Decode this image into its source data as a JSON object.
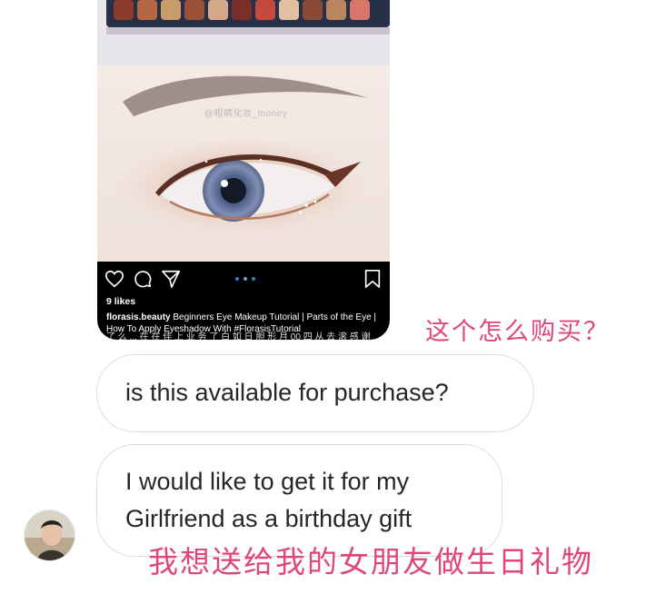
{
  "post": {
    "watermark": "@眼睛化妆_money",
    "likes": "9 likes",
    "username": "florasis.beauty",
    "caption": "Beginners Eye Makeup Tutorial | Parts of the Eye | How To Apply Eyeshadow With #FlorasisTutorial",
    "caption_cut": "了 么 ... 在 在 佳 上 业 务 了 白 如 日 胆 形 月 00 四 从 去 滚 感 谢",
    "icons": [
      "heart-icon",
      "comment-icon",
      "share-icon",
      "bookmark-icon"
    ],
    "carousel_dots": 3
  },
  "messages": [
    {
      "lines": [
        "is this available for purchase?"
      ]
    },
    {
      "lines": [
        "I would like to get it for my",
        "Girlfriend as a birthday gift"
      ]
    }
  ],
  "annotations": {
    "question": "这个怎么购买？",
    "gift": "我想送给我的女朋友做生日礼物"
  },
  "colors": {
    "annotation": "#e0457b",
    "bubble_border": "#dedede",
    "text": "#262626"
  }
}
